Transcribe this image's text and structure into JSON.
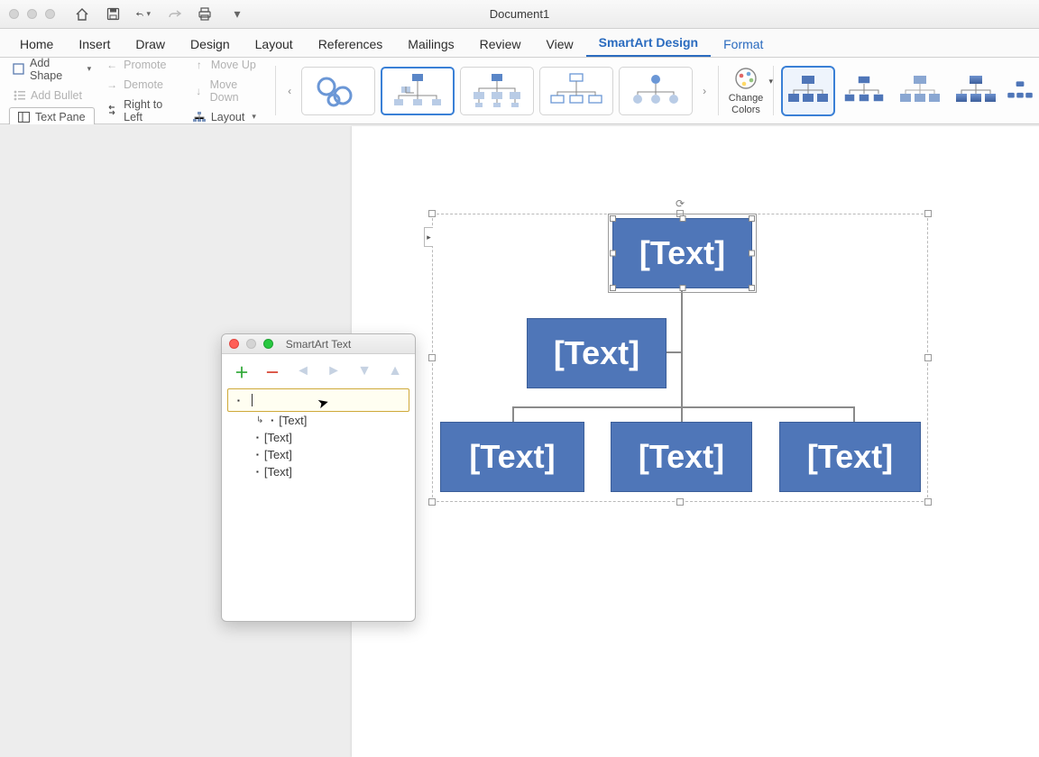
{
  "titlebar": {
    "document_name": "Document1"
  },
  "qat_icons": [
    "home-icon",
    "save-icon",
    "undo-icon",
    "redo-icon",
    "print-icon",
    "more-icon"
  ],
  "tabs": {
    "home": "Home",
    "insert": "Insert",
    "draw": "Draw",
    "design": "Design",
    "layout": "Layout",
    "references": "References",
    "mailings": "Mailings",
    "review": "Review",
    "view": "View",
    "smartart_design": "SmartArt Design",
    "format": "Format",
    "active": "smartart_design"
  },
  "ribbon": {
    "add_shape": "Add Shape",
    "add_bullet": "Add Bullet",
    "text_pane": "Text Pane",
    "promote": "Promote",
    "demote": "Demote",
    "right_to_left": "Right to Left",
    "move_up": "Move Up",
    "move_down": "Move Down",
    "layout": "Layout",
    "change_colors": "Change Colors"
  },
  "panel": {
    "title": "SmartArt Text",
    "outline": {
      "active_text": "",
      "items": [
        "[Text]",
        "[Text]",
        "[Text]",
        "[Text]"
      ]
    }
  },
  "smartart": {
    "placeholder": "[Text]",
    "nodes": {
      "top": "[Text]",
      "assistant": "[Text]",
      "child1": "[Text]",
      "child2": "[Text]",
      "child3": "[Text]"
    },
    "colors": {
      "node_fill": "#4f76b8",
      "node_border": "#3b5e99"
    }
  }
}
